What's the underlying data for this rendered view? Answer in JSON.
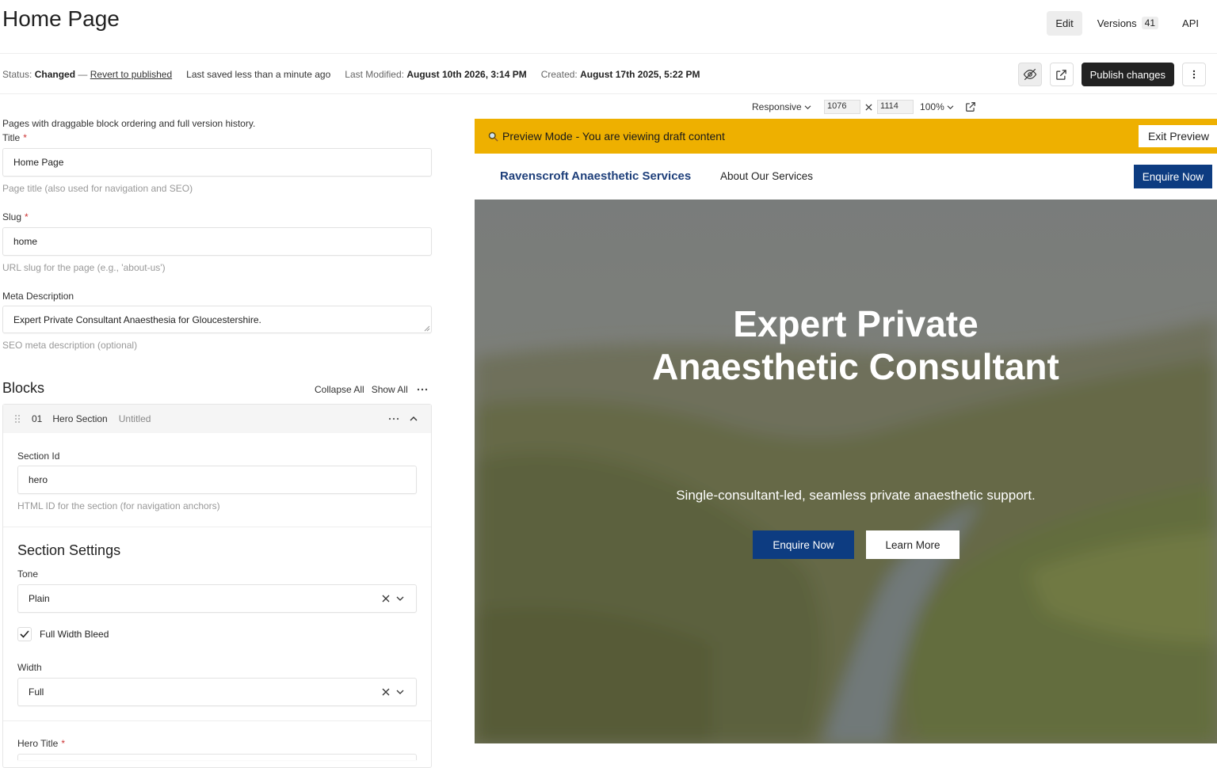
{
  "header": {
    "title": "Home Page",
    "tabs": [
      {
        "label": "Edit"
      },
      {
        "label": "Versions",
        "badge": "41"
      },
      {
        "label": "API"
      }
    ]
  },
  "status": {
    "status_label": "Status:",
    "status_value": "Changed",
    "dash": "—",
    "revert_link": "Revert to published",
    "last_saved": "Last saved less than a minute ago",
    "modified_label": "Last Modified:",
    "modified_value": "August 10th 2026, 3:14 PM",
    "created_label": "Created:",
    "created_value": "August 17th 2025, 5:22 PM",
    "publish_label": "Publish changes"
  },
  "form": {
    "description": "Pages with draggable block ordering and full version history.",
    "title_label": "Title",
    "title_value": "Home Page",
    "title_hint": "Page title (also used for navigation and SEO)",
    "slug_label": "Slug",
    "slug_value": "home",
    "slug_hint": "URL slug for the page (e.g., 'about-us')",
    "meta_label": "Meta Description",
    "meta_value": "Expert Private Consultant Anaesthesia for Gloucestershire.",
    "meta_hint": "SEO meta description (optional)",
    "required_mark": "*"
  },
  "blocks": {
    "title": "Blocks",
    "collapse_all": "Collapse All",
    "show_all": "Show All",
    "item": {
      "index": "01",
      "type": "Hero Section",
      "name": "Untitled",
      "section_id_label": "Section Id",
      "section_id_value": "hero",
      "section_id_hint": "HTML ID for the section (for navigation anchors)",
      "settings_title": "Section Settings",
      "tone_label": "Tone",
      "tone_value": "Plain",
      "full_width_label": "Full Width Bleed",
      "full_width_checked": true,
      "width_label": "Width",
      "width_value": "Full",
      "hero_title_label": "Hero Title"
    }
  },
  "preview_controls": {
    "mode": "Responsive",
    "width": "1076",
    "height": "1114",
    "zoom": "100%"
  },
  "preview": {
    "banner_text": "Preview Mode - You are viewing draft content",
    "exit_label": "Exit Preview",
    "brand": "Ravenscroft Anaesthetic Services",
    "nav_link": "About Our Services",
    "nav_cta": "Enquire Now",
    "hero_title_line1": "Expert Private",
    "hero_title_line2": "Anaesthetic Consultant",
    "hero_subtitle": "Single-consultant-led, seamless private anaesthetic support.",
    "hero_primary": "Enquire Now",
    "hero_secondary": "Learn More",
    "banner_color": "#eeb000",
    "brand_color": "#1e3f7a",
    "cta_color": "#0d3c81"
  }
}
